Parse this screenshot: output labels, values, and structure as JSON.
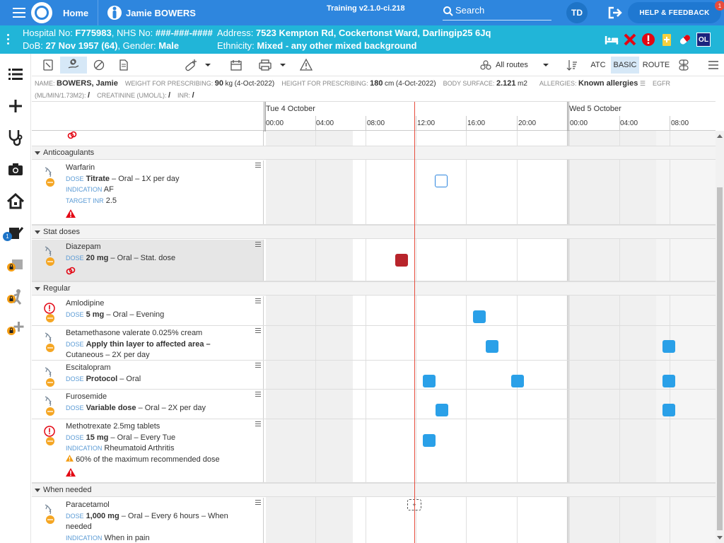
{
  "topbar": {
    "home": "Home",
    "patient_name": "Jamie BOWERS",
    "training": "Training v2.1.0-ci.218",
    "search": "Search",
    "avatar": "TD",
    "help": "HELP & FEEDBACK",
    "help_badge": "1"
  },
  "banner": {
    "hospital_label": "Hospital No: ",
    "hospital_no": "F775983",
    "nhs_label": ", NHS No: ",
    "nhs_no": "###-###-####",
    "address_label": "Address: ",
    "address": "7523 Kempton Rd, Cockertonst Ward, Darlingip25 6Jq",
    "dob_label": "DoB: ",
    "dob": "27 Nov 1957 (64)",
    "gender_label": ", Gender: ",
    "gender": "Male",
    "ethnicity_label": "Ethnicity: ",
    "ethnicity": "Mixed - any other mixed background",
    "badge_ol": "OL"
  },
  "nav": {
    "badge_1": "1"
  },
  "toolbar": {
    "routes": "All routes",
    "atc": "ATC",
    "basic": "BASIC",
    "route": "ROUTE"
  },
  "info": {
    "name_label": "NAME:",
    "name": "BOWERS, Jamie",
    "weight_label": "WEIGHT FOR PRESCRIBING:",
    "weight": "90",
    "weight_unit": "kg",
    "weight_date": "(4-Oct-2022)",
    "height_label": "HEIGHT FOR PRESCRIBING:",
    "height": "180",
    "height_unit": "cm",
    "height_date": "(4-Oct-2022)",
    "bsa_label": "BODY SURFACE:",
    "bsa": "2.121",
    "bsa_unit": "m2",
    "allergies_label": "ALLERGIES:",
    "allergies": "Known allergies",
    "egfr_label": "EGFR",
    "egfr_unit": "(ML/MIN/1.73M2):",
    "egfr": "/",
    "creat_label": "CREATININE (UMOL/L):",
    "creat": "/",
    "inr_label": "INR:",
    "inr": "/"
  },
  "timeline": {
    "day1": "Tue 4 October",
    "day2": "Wed 5 October",
    "hours": [
      "00:00",
      "04:00",
      "08:00",
      "12:00",
      "16:00",
      "20:00",
      "00:00",
      "04:00",
      "08:00"
    ]
  },
  "sections": {
    "anticoag": "Anticoagulants",
    "stat": "Stat doses",
    "regular": "Regular",
    "prn": "When needed"
  },
  "labels": {
    "dose": "DOSE",
    "indication": "INDICATION",
    "target_inr": "TARGET INR"
  },
  "meds": {
    "warfarin": {
      "name": "Warfarin",
      "dose": "Titrate",
      "rest": " – Oral – 1X per day",
      "indication": "AF",
      "target": "2.5"
    },
    "diazepam": {
      "name": "Diazepam",
      "dose": "20 mg",
      "rest": " – Oral – Stat. dose"
    },
    "amlodipine": {
      "name": "Amlodipine",
      "dose": "5 mg",
      "rest": " – Oral – Evening"
    },
    "betamethasone": {
      "name": "Betamethasone valerate 0.025% cream",
      "dose": "Apply thin layer to affected area –",
      "rest": "Cutaneous – 2X per day"
    },
    "escitalopram": {
      "name": "Escitalopram",
      "dose": "Protocol",
      "rest": " – Oral"
    },
    "furosemide": {
      "name": "Furosemide",
      "dose": "Variable dose",
      "rest": " – Oral – 2X per day"
    },
    "methotrexate": {
      "name": "Methotrexate 2.5mg tablets",
      "dose": "15 mg",
      "rest": " – Oral – Every Tue",
      "indication": "Rheumatoid Arthritis",
      "warning": "60% of the maximum recommended dose"
    },
    "paracetamol": {
      "name": "Paracetamol",
      "dose": "1,000 mg",
      "rest": " – Oral – Every 6 hours – When",
      "rest2": "needed",
      "indication": "When in pain"
    }
  },
  "prn_marker": "+"
}
